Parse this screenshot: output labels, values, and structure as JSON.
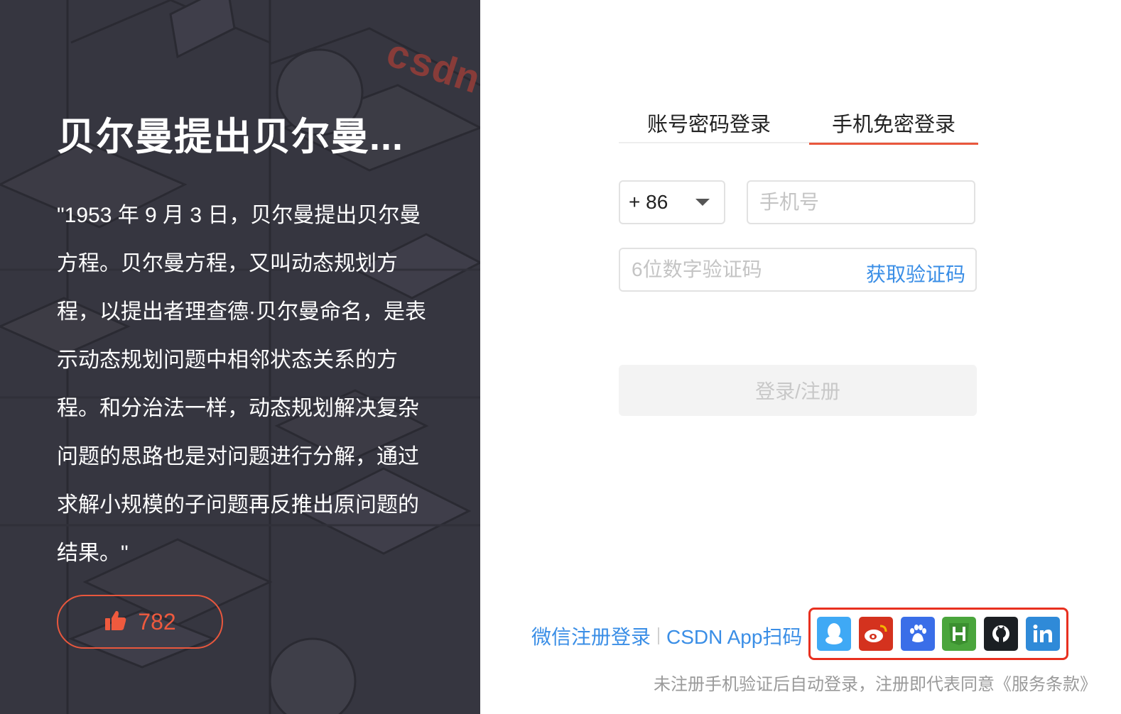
{
  "quote": {
    "title": "贝尔曼提出贝尔曼...",
    "body": "\"1953 年 9 月 3 日，贝尔曼提出贝尔曼方程。贝尔曼方程，又叫动态规划方程，以提出者理查德·贝尔曼命名，是表示动态规划问题中相邻状态关系的方程。和分治法一样，动态规划解决复杂问题的思路也是对问题进行分解，通过求解小规模的子问题再反推出原问题的结果。\"",
    "likes": "782"
  },
  "login": {
    "tabs": [
      {
        "label": "账号密码登录",
        "active": false
      },
      {
        "label": "手机免密登录",
        "active": true
      }
    ],
    "country_code": "+ 86",
    "phone_placeholder": "手机号",
    "code_placeholder": "6位数字验证码",
    "get_code_label": "获取验证码",
    "submit_label": "登录/注册",
    "wechat_label": "微信注册登录",
    "app_scan_label": "CSDN App扫码",
    "terms": "未注册手机验证后自动登录，注册即代表同意《服务条款》"
  },
  "colors": {
    "accent": "#e9573d",
    "link": "#3a8ee6",
    "qq": "#3fa9f5",
    "weibo": "#d4321e",
    "baidu": "#3a6ee8",
    "huawei": "#4aa53c",
    "github": "#1b1f23",
    "linkedin": "#2f8ad8"
  }
}
